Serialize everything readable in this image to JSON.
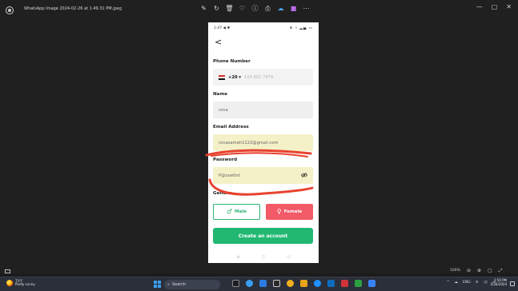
{
  "window": {
    "title": "WhatsApp Image 2024-02-26 at 1.49.31 PM.jpeg",
    "toolbar_icons": [
      "edit-icon",
      "rotate-icon",
      "delete-icon",
      "favorite-icon",
      "info-icon",
      "print-icon",
      "cloud-icon",
      "clipchamp-icon",
      "more-icon"
    ],
    "controls": {
      "minimize": "—",
      "maximize": "▢",
      "close": "✕"
    }
  },
  "phone": {
    "status_time": "1:47",
    "status_left_icons": "◀ ✱",
    "status_right_icons": "⊕ ▿ ▂▄ ▭",
    "back": "<",
    "phone_label": "Phone Number",
    "country_code": "+20 ▾",
    "phone_placeholder": "100 802 7878",
    "name_label": "Name",
    "name_value": "rona",
    "email_label": "Email Address",
    "email_value": "ronasameh1122@gmail.com",
    "password_label": "Password",
    "password_value": "P@ssw0rd",
    "gender_label": "Gender",
    "male_label": "Male",
    "female_label": "Female",
    "create_label": "Create an account",
    "nav": [
      "≡",
      "○",
      "◁"
    ]
  },
  "viewer_bottom": {
    "zoom": "100%"
  },
  "taskbar": {
    "weather_temp": "73°F",
    "weather_desc": "Partly sunny",
    "search": "Search",
    "tray_lang": "ENG",
    "clock_time": "2:50 PM",
    "clock_date": "2/26/2024"
  },
  "colors": {
    "accent_green": "#22b872",
    "female_red": "#f25a68",
    "field_yellow": "#f4f1c8",
    "scribble_red": "#e8422f"
  }
}
